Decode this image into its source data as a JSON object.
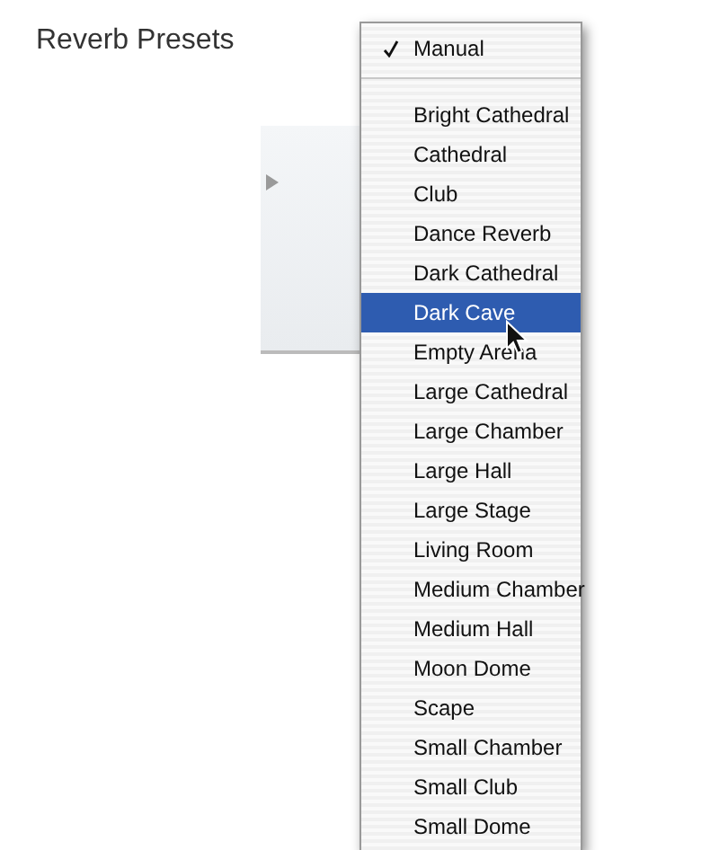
{
  "label": "Reverb Presets",
  "menu": {
    "groups": [
      {
        "items": [
          {
            "text": "Manual",
            "checked": true,
            "selected": false
          }
        ]
      },
      {
        "items": [
          {
            "text": "Bright Cathedral",
            "checked": false,
            "selected": false
          },
          {
            "text": "Cathedral",
            "checked": false,
            "selected": false
          },
          {
            "text": "Club",
            "checked": false,
            "selected": false
          },
          {
            "text": "Dance Reverb",
            "checked": false,
            "selected": false
          },
          {
            "text": "Dark Cathedral",
            "checked": false,
            "selected": false
          },
          {
            "text": "Dark Cave",
            "checked": false,
            "selected": true
          },
          {
            "text": "Empty Arena",
            "checked": false,
            "selected": false
          },
          {
            "text": "Large Cathedral",
            "checked": false,
            "selected": false
          },
          {
            "text": "Large Chamber",
            "checked": false,
            "selected": false
          },
          {
            "text": "Large Hall",
            "checked": false,
            "selected": false
          },
          {
            "text": "Large Stage",
            "checked": false,
            "selected": false
          },
          {
            "text": "Living Room",
            "checked": false,
            "selected": false
          },
          {
            "text": "Medium Chamber",
            "checked": false,
            "selected": false
          },
          {
            "text": "Medium Hall",
            "checked": false,
            "selected": false
          },
          {
            "text": "Moon Dome",
            "checked": false,
            "selected": false
          },
          {
            "text": "Scape",
            "checked": false,
            "selected": false
          },
          {
            "text": "Small Chamber",
            "checked": false,
            "selected": false
          },
          {
            "text": "Small Club",
            "checked": false,
            "selected": false
          },
          {
            "text": "Small Dome",
            "checked": false,
            "selected": false
          }
        ]
      }
    ]
  }
}
